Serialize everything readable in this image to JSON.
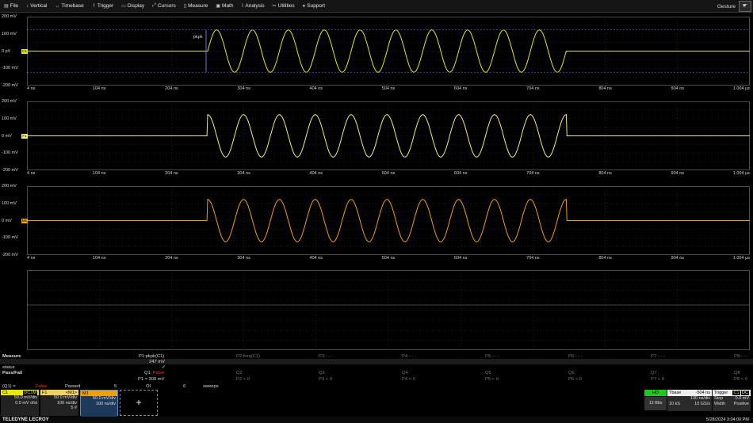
{
  "menu": [
    {
      "icon": "file-icon",
      "glyph": "▤",
      "label": "File"
    },
    {
      "icon": "vertical-icon",
      "glyph": "↕",
      "label": "Vertical"
    },
    {
      "icon": "timebase-icon",
      "glyph": "↔",
      "label": "Timebase"
    },
    {
      "icon": "trigger-icon",
      "glyph": "↾",
      "label": "Trigger"
    },
    {
      "icon": "display-icon",
      "glyph": "▭",
      "label": "Display"
    },
    {
      "icon": "cursors-icon",
      "glyph": "⤢",
      "label": "Cursors"
    },
    {
      "icon": "measure-icon",
      "glyph": "▯",
      "label": "Measure"
    },
    {
      "icon": "math-icon",
      "glyph": "▣",
      "label": "Math"
    },
    {
      "icon": "analysis-icon",
      "glyph": "⌇",
      "label": "Analysis"
    },
    {
      "icon": "utilities-icon",
      "glyph": "✂",
      "label": "Utilities"
    },
    {
      "icon": "support-icon",
      "glyph": "●",
      "label": "Support"
    }
  ],
  "gesture_label": "Gesture",
  "grids": [
    {
      "name": "C1",
      "color": "#e8e800",
      "ylabels": [
        "200 mV",
        "100 mV",
        "0 pV",
        "-100 mV",
        "-200 mV"
      ],
      "marker": "C1",
      "pkpk_label": "pkpk"
    },
    {
      "name": "F1",
      "color": "#f0f070",
      "ylabels": [
        "200 mV",
        "100 mV",
        "0 mV",
        "-100 mV",
        "-200 mV"
      ],
      "marker": "F1"
    },
    {
      "name": "M1",
      "color": "#f0a000",
      "ylabels": [
        "200 mV",
        "100 mV",
        "0 mV",
        "-100 mV",
        "-200 mV"
      ],
      "marker": "M1"
    }
  ],
  "xlabels": [
    "4 ns",
    "104 ns",
    "204 ns",
    "304 ns",
    "404 ns",
    "504 ns",
    "604 ns",
    "704 ns",
    "804 ns",
    "904 ns",
    "1.004 µs"
  ],
  "chart_data": {
    "type": "line",
    "title": "",
    "x_unit": "ns",
    "xlim": [
      4,
      1004
    ],
    "ylim_mV": [
      -200,
      200
    ],
    "burst": {
      "start_ns": 254,
      "end_ns": 750,
      "cycles": 10,
      "amplitude_mV": 123,
      "baseline_mV": 0
    },
    "series": [
      {
        "name": "C1",
        "channel_color": "#e8e800",
        "phase": "sine"
      },
      {
        "name": "F1",
        "channel_color": "#f0f070",
        "phase": "cosine"
      },
      {
        "name": "M1",
        "channel_color": "#f0a000",
        "phase": "cosine"
      }
    ]
  },
  "measure": {
    "label": "Measure",
    "rows": [
      "value",
      "status"
    ],
    "passfail_label": "Pass/Fail",
    "p1": {
      "name": "P1:pkpk(C1)",
      "value": "247 mV",
      "status": "✔"
    },
    "params": [
      {
        "name": "P2:freq(C1)",
        "q": "Q2",
        "cond": "P2 < 0"
      },
      {
        "name": "P3:- - -",
        "q": "Q3",
        "cond": "P3 < 0"
      },
      {
        "name": "P4:- - -",
        "q": "Q4",
        "cond": "P4 < 0"
      },
      {
        "name": "P5:- - -",
        "q": "Q5",
        "cond": "P5 < 0"
      },
      {
        "name": "P6:- - -",
        "q": "Q6",
        "cond": "P6 < 0"
      },
      {
        "name": "P7:- - -",
        "q": "Q7",
        "cond": "P7 < 0"
      },
      {
        "name": "P8:- - -",
        "q": "Q8",
        "cond": "P8 < 0"
      }
    ],
    "q1_label": "Q1:",
    "q1_result": "False",
    "q1_cond": "P1 ≈ 300 mV",
    "q1_row": {
      "lead": "(Q1) =",
      "result": "False",
      "passed_label": "Passed",
      "passed_value": "5",
      "oi_label": "OI",
      "oi_value": "6",
      "sweeps_label": "sweeps"
    }
  },
  "channels": [
    {
      "name": "C1",
      "badge": "DC1M",
      "head_color": "#e8e800",
      "lines": [
        "50.0 mV/div",
        "0.0 mV ofst"
      ]
    },
    {
      "name": "F1",
      "badge": "<M1>",
      "head_color": "#f0d060",
      "lines": [
        "50.0 mV/div",
        "100 ns/div",
        "5 #"
      ]
    },
    {
      "name": "M1",
      "badge": "",
      "head_color": "#f0a000",
      "lines": [
        "50.0 mV/div",
        "100 ns/div"
      ]
    }
  ],
  "add_button": "+",
  "acq": {
    "hd": "HD",
    "bits": "12 Bits"
  },
  "timebase": {
    "label": "Tbase",
    "offset": "-504 ns",
    "div": "100 ns/div",
    "samples": "10 kS",
    "rate": "10 GS/s"
  },
  "trigger": {
    "label": "Trigger",
    "badge1": "C1",
    "badge2": "DC",
    "mode": "Stop",
    "level": "0.0 mV",
    "type": "Width",
    "slope": "Positive"
  },
  "brand": "TELEDYNE LECROY",
  "datetime": "5/28/2024 3:04:00 PM"
}
